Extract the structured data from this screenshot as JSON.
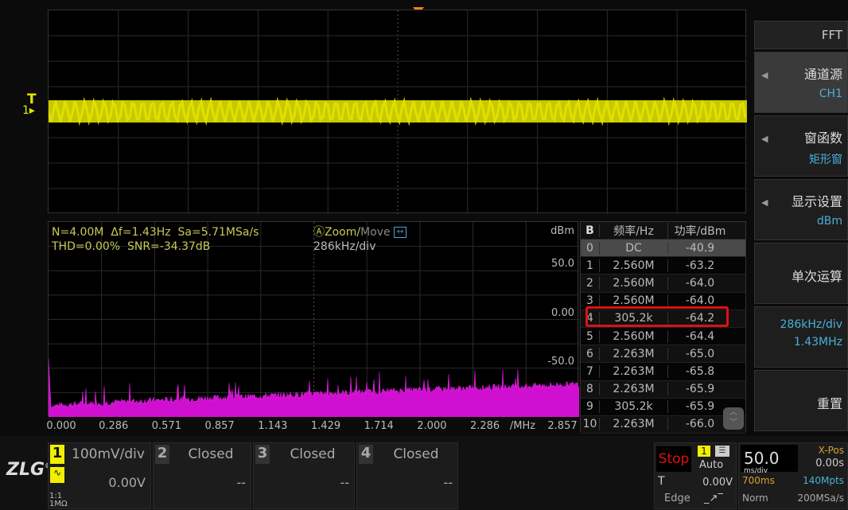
{
  "trigger_marker": {
    "label": "T",
    "channel": "1"
  },
  "fft": {
    "info_line1": "N=4.00M  Δf=1.43Hz  Sa=5.71MSa/s",
    "info_line2": "THD=0.00%  SNR=-34.37dB",
    "zoom_label": "Zoom/",
    "move_label": "Move",
    "scale": "286kHz/div",
    "unit": "dBm",
    "y_ticks": [
      "50.0",
      "0.00",
      "-50.0"
    ],
    "x_ticks": [
      "0.000",
      "0.286",
      "0.571",
      "0.857",
      "1.143",
      "1.429",
      "1.714",
      "2.000",
      "2.286",
      "/MHz",
      "2.857"
    ]
  },
  "table": {
    "badge": "B",
    "headers": [
      "频率/Hz",
      "功率/dBm"
    ],
    "rows": [
      [
        "0",
        "DC",
        "-40.9"
      ],
      [
        "1",
        "2.560M",
        "-63.2"
      ],
      [
        "2",
        "2.560M",
        "-64.0"
      ],
      [
        "3",
        "2.560M",
        "-64.0"
      ],
      [
        "4",
        "305.2k",
        "-64.2"
      ],
      [
        "5",
        "2.560M",
        "-64.4"
      ],
      [
        "6",
        "2.263M",
        "-65.0"
      ],
      [
        "7",
        "2.263M",
        "-65.8"
      ],
      [
        "8",
        "2.263M",
        "-65.9"
      ],
      [
        "9",
        "305.2k",
        "-65.9"
      ],
      [
        "10",
        "2.263M",
        "-66.0"
      ]
    ],
    "selected_row": 0,
    "highlighted_row": 4
  },
  "menu": {
    "title": "FFT",
    "items": [
      {
        "label": "通道源",
        "value": "CH1"
      },
      {
        "label": "窗函数",
        "value": "矩形窗"
      },
      {
        "label": "显示设置",
        "value": "dBm"
      },
      {
        "label": "单次运算",
        "value": ""
      },
      {
        "label": "286kHz/div",
        "value": "1.43MHz"
      },
      {
        "label": "重置",
        "value": ""
      }
    ]
  },
  "bottom": {
    "logo": "ZLG",
    "ch1": {
      "num": "1",
      "scale": "100mV/div",
      "offset": "0.00V",
      "probe": "1:1",
      "imp": "1MΩ"
    },
    "ch2": {
      "num": "2",
      "scale": "Closed",
      "offset": "--"
    },
    "ch3": {
      "num": "3",
      "scale": "Closed",
      "offset": "--"
    },
    "ch4": {
      "num": "4",
      "scale": "Closed",
      "offset": "--"
    },
    "run_state": "Stop",
    "trig_src": "1",
    "trig_mode": "Auto",
    "trig_label": "T",
    "trig_level": "0.00V",
    "trig_type": "Edge",
    "timebase": "50.0",
    "timebase_unit": "ms/div",
    "xpos_label": "X-Pos",
    "xpos": "0.00s",
    "duration": "700ms",
    "mem": "140Mpts",
    "acq": "Norm",
    "rate": "200MSa/s"
  },
  "colors": {
    "ch1": "#e6e600",
    "math": "#e020e0",
    "accent": "#4ab0d8",
    "stop": "#e01010"
  }
}
